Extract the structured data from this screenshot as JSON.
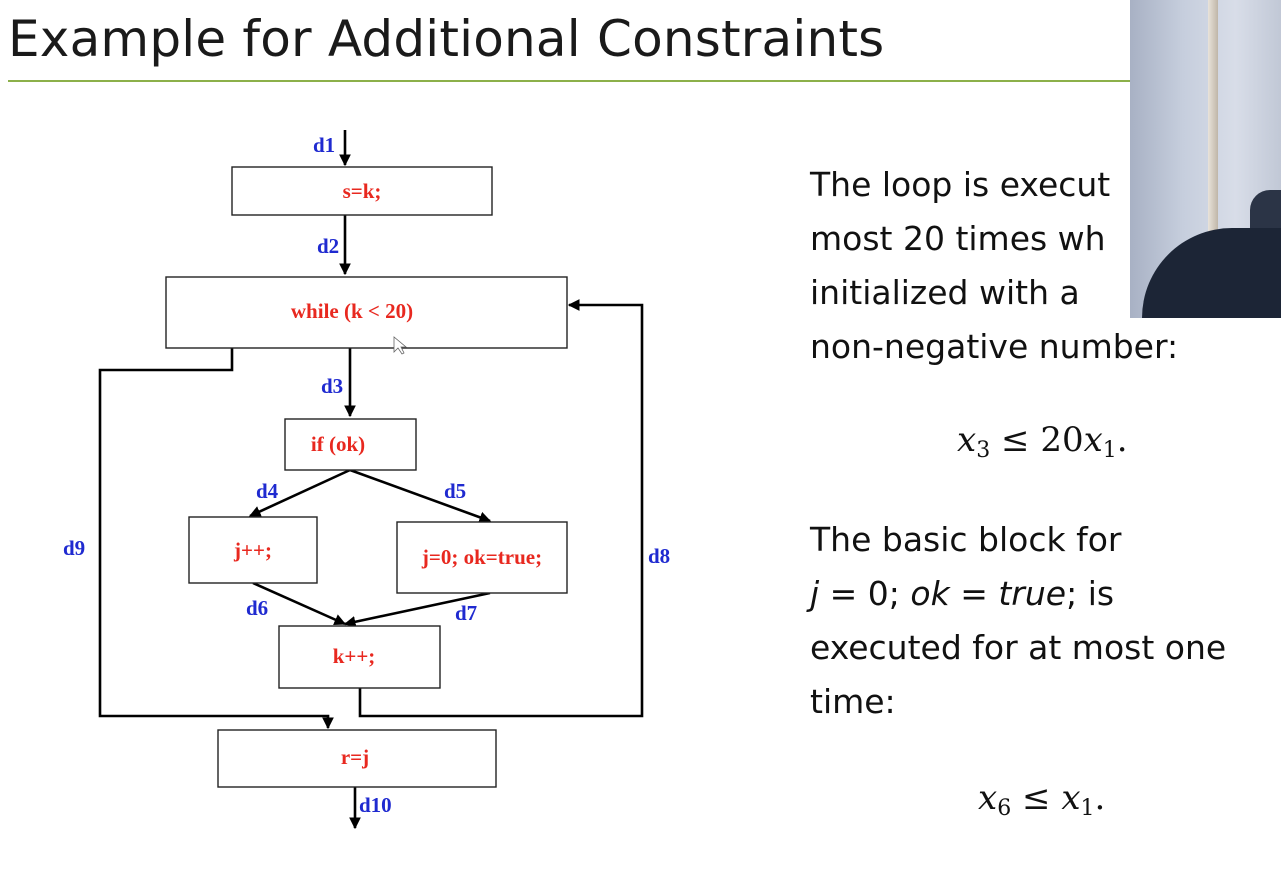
{
  "slide": {
    "title": "Example for Additional Constraints"
  },
  "diagram": {
    "nodes": {
      "s_assign": "s=k;",
      "while_loop": "while (k < 20)",
      "if_ok": "if (ok)",
      "j_inc": "j++;",
      "j_reset": "j=0; ok=true;",
      "k_inc": "k++;",
      "r_assign": "r=j"
    },
    "edges": {
      "d1": "d1",
      "d2": "d2",
      "d3": "d3",
      "d4": "d4",
      "d5": "d5",
      "d6": "d6",
      "d7": "d7",
      "d8": "d8",
      "d9": "d9",
      "d10": "d10"
    }
  },
  "text": {
    "para1": [
      "The loop is execut",
      "most 20 times wh",
      "initialized with a",
      "non-negative number:"
    ],
    "eq1": {
      "var": "x",
      "sub": "3",
      "op": "≤",
      "coef": "20",
      "rhs_var": "x",
      "rhs_sub": "1",
      "end": "."
    },
    "para2_line1": "The basic block for",
    "para2_line2": {
      "j": "j",
      "eq": " = 0; ",
      "ok": "ok",
      "eq2": " = ",
      "true": "true",
      "tail": "; is"
    },
    "para2_rest": [
      "executed for at most one",
      "time:"
    ],
    "eq2": {
      "var": "x",
      "sub": "6",
      "op": "≤",
      "rhs_var": "x",
      "rhs_sub": "1",
      "end": "."
    }
  },
  "colors": {
    "accent_rule": "#8cb04a",
    "node_text": "#e8281f",
    "edge_label": "#1f2ad0"
  }
}
